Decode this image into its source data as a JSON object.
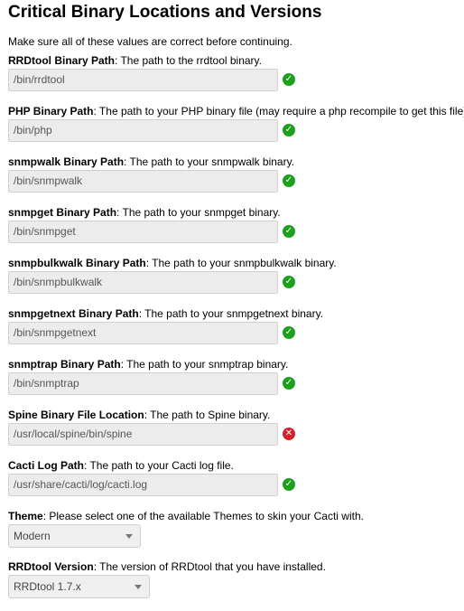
{
  "section": {
    "title": "Critical Binary Locations and Versions",
    "intro": "Make sure all of these values are correct before continuing."
  },
  "fields": [
    {
      "label": "RRDtool Binary Path",
      "desc": ": The path to the rrdtool binary.",
      "value": "/bin/rrdtool",
      "status": "ok"
    },
    {
      "label": "PHP Binary Path",
      "desc": ": The path to your PHP binary file (may require a php recompile to get this file).",
      "value": "/bin/php",
      "status": "ok"
    },
    {
      "label": "snmpwalk Binary Path",
      "desc": ": The path to your snmpwalk binary.",
      "value": "/bin/snmpwalk",
      "status": "ok"
    },
    {
      "label": "snmpget Binary Path",
      "desc": ": The path to your snmpget binary.",
      "value": "/bin/snmpget",
      "status": "ok"
    },
    {
      "label": "snmpbulkwalk Binary Path",
      "desc": ": The path to your snmpbulkwalk binary.",
      "value": "/bin/snmpbulkwalk",
      "status": "ok"
    },
    {
      "label": "snmpgetnext Binary Path",
      "desc": ": The path to your snmpgetnext binary.",
      "value": "/bin/snmpgetnext",
      "status": "ok"
    },
    {
      "label": "snmptrap Binary Path",
      "desc": ": The path to your snmptrap binary.",
      "value": "/bin/snmptrap",
      "status": "ok"
    },
    {
      "label": "Spine Binary File Location",
      "desc": ": The path to Spine binary.",
      "value": "/usr/local/spine/bin/spine",
      "status": "error"
    },
    {
      "label": "Cacti Log Path",
      "desc": ": The path to your Cacti log file.",
      "value": "/usr/share/cacti/log/cacti.log",
      "status": "ok"
    }
  ],
  "theme": {
    "label": "Theme",
    "desc": ": Please select one of the available Themes to skin your Cacti with.",
    "selected": "Modern"
  },
  "rrdtool_version": {
    "label": "RRDtool Version",
    "desc": ": The version of RRDtool that you have installed.",
    "selected": "RRDtool 1.7.x"
  },
  "icons": {
    "ok": "check-circle-icon",
    "error": "x-circle-icon"
  },
  "colors": {
    "ok": "#1ea01e",
    "error": "#d0232b",
    "input_bg": "#ececec"
  }
}
